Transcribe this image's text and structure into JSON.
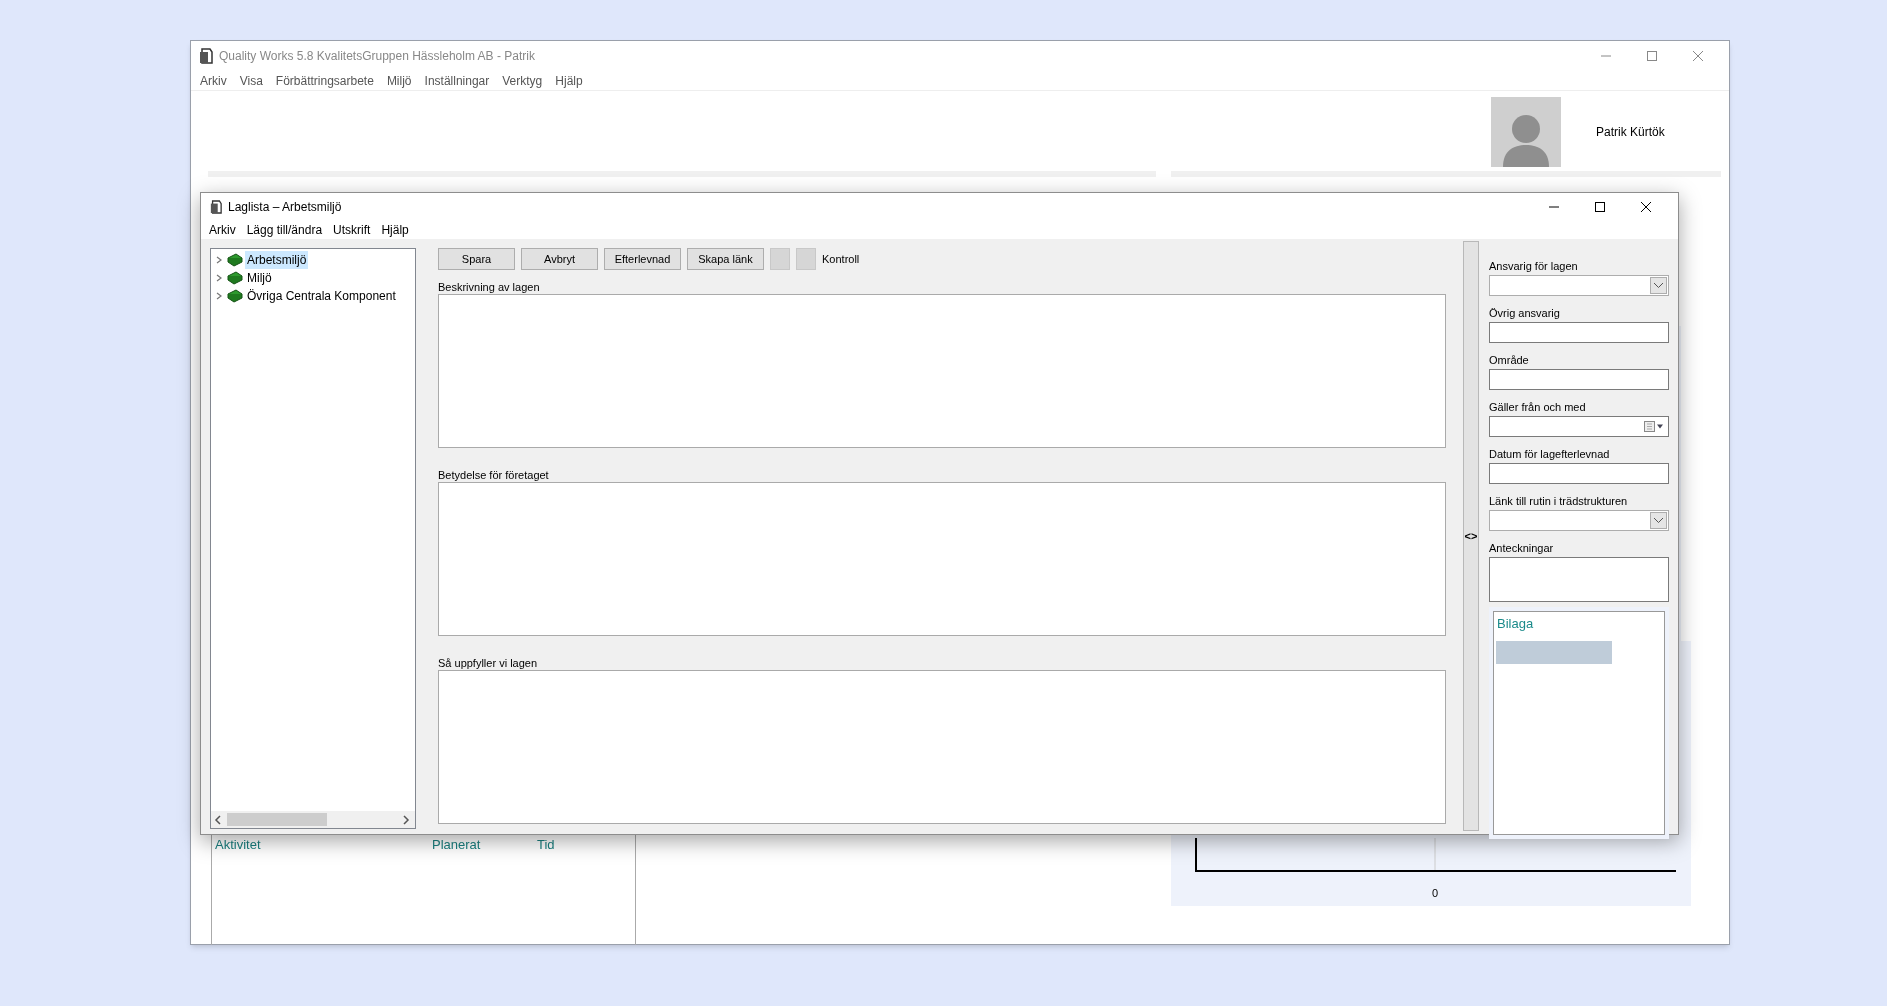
{
  "main_window": {
    "title": "Quality Works 5.8 KvalitetsGruppen Hässleholm AB - Patrik",
    "menu": [
      "Arkiv",
      "Visa",
      "Förbättringsarbete",
      "Miljö",
      "Inställningar",
      "Verktyg",
      "Hjälp"
    ],
    "user_name": "Patrik Kürtök",
    "activity_columns": [
      "Aktivitet",
      "Planerat",
      "Tid"
    ],
    "chart_tick": "0"
  },
  "dialog": {
    "title": "Laglista – Arbetsmiljö",
    "menu": [
      "Arkiv",
      "Lägg till/ändra",
      "Utskrift",
      "Hjälp"
    ],
    "tree": [
      {
        "label": "Arbetsmiljö",
        "selected": true,
        "expanded": false
      },
      {
        "label": "Miljö",
        "selected": false,
        "expanded": false
      },
      {
        "label": "Övriga Centrala Komponent",
        "selected": false,
        "expanded": false
      }
    ],
    "toolbar": [
      {
        "kind": "button",
        "label": "Spara"
      },
      {
        "kind": "button",
        "label": "Avbryt"
      },
      {
        "kind": "button",
        "label": "Efterlevnad"
      },
      {
        "kind": "button",
        "label": "Skapa länk"
      },
      {
        "kind": "swatch"
      },
      {
        "kind": "swatch"
      },
      {
        "kind": "label",
        "label": "Kontroll"
      }
    ],
    "sections": [
      {
        "label": "Beskrivning av lagen"
      },
      {
        "label": "Betydelse för företaget"
      },
      {
        "label": "Så uppfyller vi lagen"
      }
    ],
    "splitter": "<>",
    "fields": [
      {
        "kind": "dropdown",
        "label": "Ansvarig för lagen"
      },
      {
        "kind": "text",
        "label": "Övrig ansvarig"
      },
      {
        "kind": "text",
        "label": "Område"
      },
      {
        "kind": "date",
        "label": "Gäller från och med"
      },
      {
        "kind": "text",
        "label": "Datum för lagefterlevnad"
      },
      {
        "kind": "dropdown",
        "label": "Länk till rutin i trädstrukturen"
      },
      {
        "kind": "notes",
        "label": "Anteckningar"
      }
    ],
    "attachment": {
      "title": "Bilaga"
    }
  }
}
